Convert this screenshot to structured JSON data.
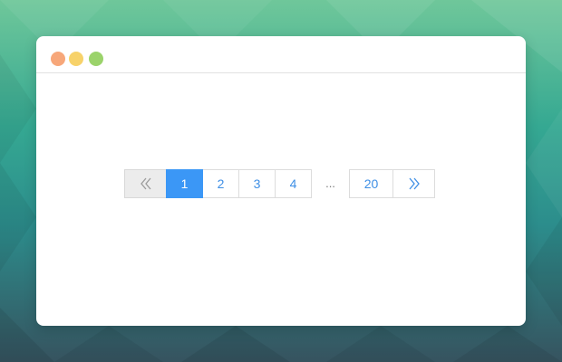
{
  "colors": {
    "accent": "#3b97f6",
    "link": "#3e8fe5",
    "traffic_red": "#f7a77a",
    "traffic_yellow": "#f7d26a",
    "traffic_green": "#9bd36b"
  },
  "pagination": {
    "prev_icon": "double-chevron-left-icon",
    "pages": [
      "1",
      "2",
      "3",
      "4"
    ],
    "ellipsis": "...",
    "last_page": "20",
    "next_icon": "double-chevron-right-icon",
    "current_page": "1"
  }
}
